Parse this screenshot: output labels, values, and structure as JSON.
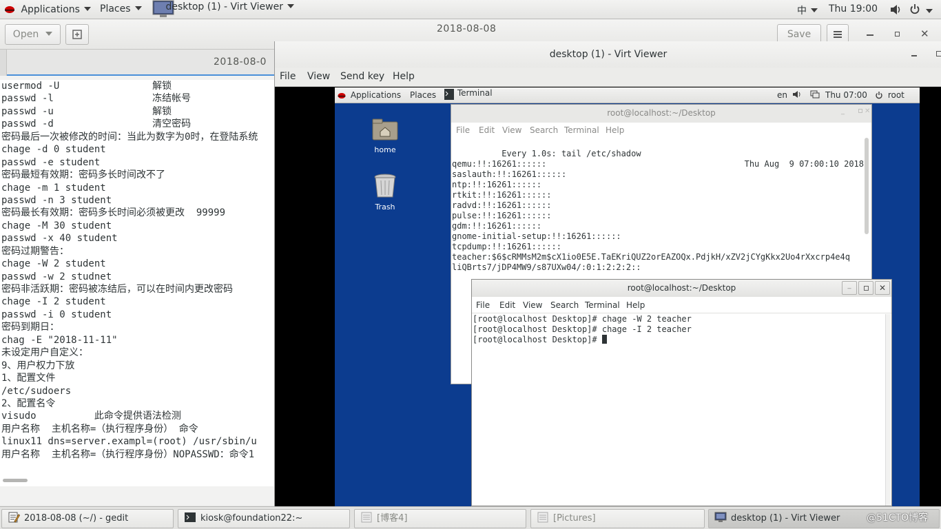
{
  "top_panel": {
    "applications": "Applications",
    "places": "Places",
    "window_title": "desktop (1) - Virt Viewer",
    "input_method": "中",
    "clock": "Thu 19:00"
  },
  "gedit": {
    "open_label": "Open",
    "title_date": "2018-08-08",
    "save_label": "Save",
    "tab_label": "2018-08-0",
    "lines": [
      "usermod -U                解锁",
      "passwd -l                 冻结帐号",
      "passwd -u                 解锁",
      "passwd -d                 清空密码",
      "密码最后一次被修改的时间：当此为数字为0时，在登陆系统",
      "chage -d 0 student",
      "passwd -e student",
      "密码最短有效期：密码多长时间改不了",
      "chage -m 1 student",
      "passwd -n 3 student",
      "密码最长有效期：密码多长时间必须被更改  99999",
      "chage -M 30 student",
      "passwd -x 40 student",
      "密码过期警告：",
      "chage -W 2 student",
      "passwd -w 2 studnet",
      "密码非活跃期：密码被冻结后，可以在时间内更改密码",
      "chage -I 2 student",
      "passwd -i 0 student",
      "密码到期日：",
      "chag -E \"2018-11-11\"",
      "未设定用户自定义：",
      "9、用户权力下放",
      "1、配置文件",
      "/etc/sudoers",
      "2、配置名令",
      "visudo          此命令提供语法检测",
      "用户名称  主机名称=（执行程序身份） 命令",
      "linux11 dns=server.exampl=(root) /usr/sbin/u",
      "用户名称  主机名称=（执行程序身份）NOPASSWD：命令1"
    ]
  },
  "virt_viewer": {
    "title": "desktop (1) - Virt Viewer",
    "menu": [
      "File",
      "View",
      "Send key",
      "Help"
    ]
  },
  "guest": {
    "panel": {
      "applications": "Applications",
      "places": "Places",
      "terminal": "Terminal",
      "lang": "en",
      "clock": "Thu 07:00",
      "user": "root"
    },
    "desktop_icons": {
      "home": "home",
      "trash": "Trash"
    },
    "terminal_back": {
      "title": "root@localhost:~/Desktop",
      "menu": [
        "File",
        "Edit",
        "View",
        "Search",
        "Terminal",
        "Help"
      ],
      "header_left": "Every 1.0s: tail /etc/shadow",
      "header_right": "Thu Aug  9 07:00:10 2018",
      "lines": [
        "qemu:!!:16261::::::",
        "saslauth:!!:16261::::::",
        "ntp:!!:16261::::::",
        "rtkit:!!:16261::::::",
        "radvd:!!:16261::::::",
        "pulse:!!:16261::::::",
        "gdm:!!:16261::::::",
        "gnome-initial-setup:!!:16261::::::",
        "tcpdump:!!:16261::::::",
        "teacher:$6$cRMMsM2m$cX1io0E5E.TaEKriQUZ2orEAZOQx.PdjkH/xZV2jCYgKkx2Uo4rXxcrp4e4q",
        "liQBrts7/jDP4MW9/s87UXw04/:0:1:2:2:2::"
      ]
    },
    "terminal_front": {
      "title": "root@localhost:~/Desktop",
      "menu": [
        "File",
        "Edit",
        "View",
        "Search",
        "Terminal",
        "Help"
      ],
      "lines": [
        "[root@localhost Desktop]# chage -W 2 teacher",
        "[root@localhost Desktop]# chage -I 2 teacher",
        "[root@localhost Desktop]# "
      ]
    }
  },
  "taskbar": {
    "items": [
      "2018-08-08 (~/) - gedit",
      "kiosk@foundation22:~",
      "[博客4]",
      "[Pictures]",
      "desktop (1) - Virt Viewer"
    ],
    "watermark": "@51CTO博客"
  },
  "colors": {
    "guest_desktop": "#0c3c8f",
    "accent": "#4a90d9"
  }
}
